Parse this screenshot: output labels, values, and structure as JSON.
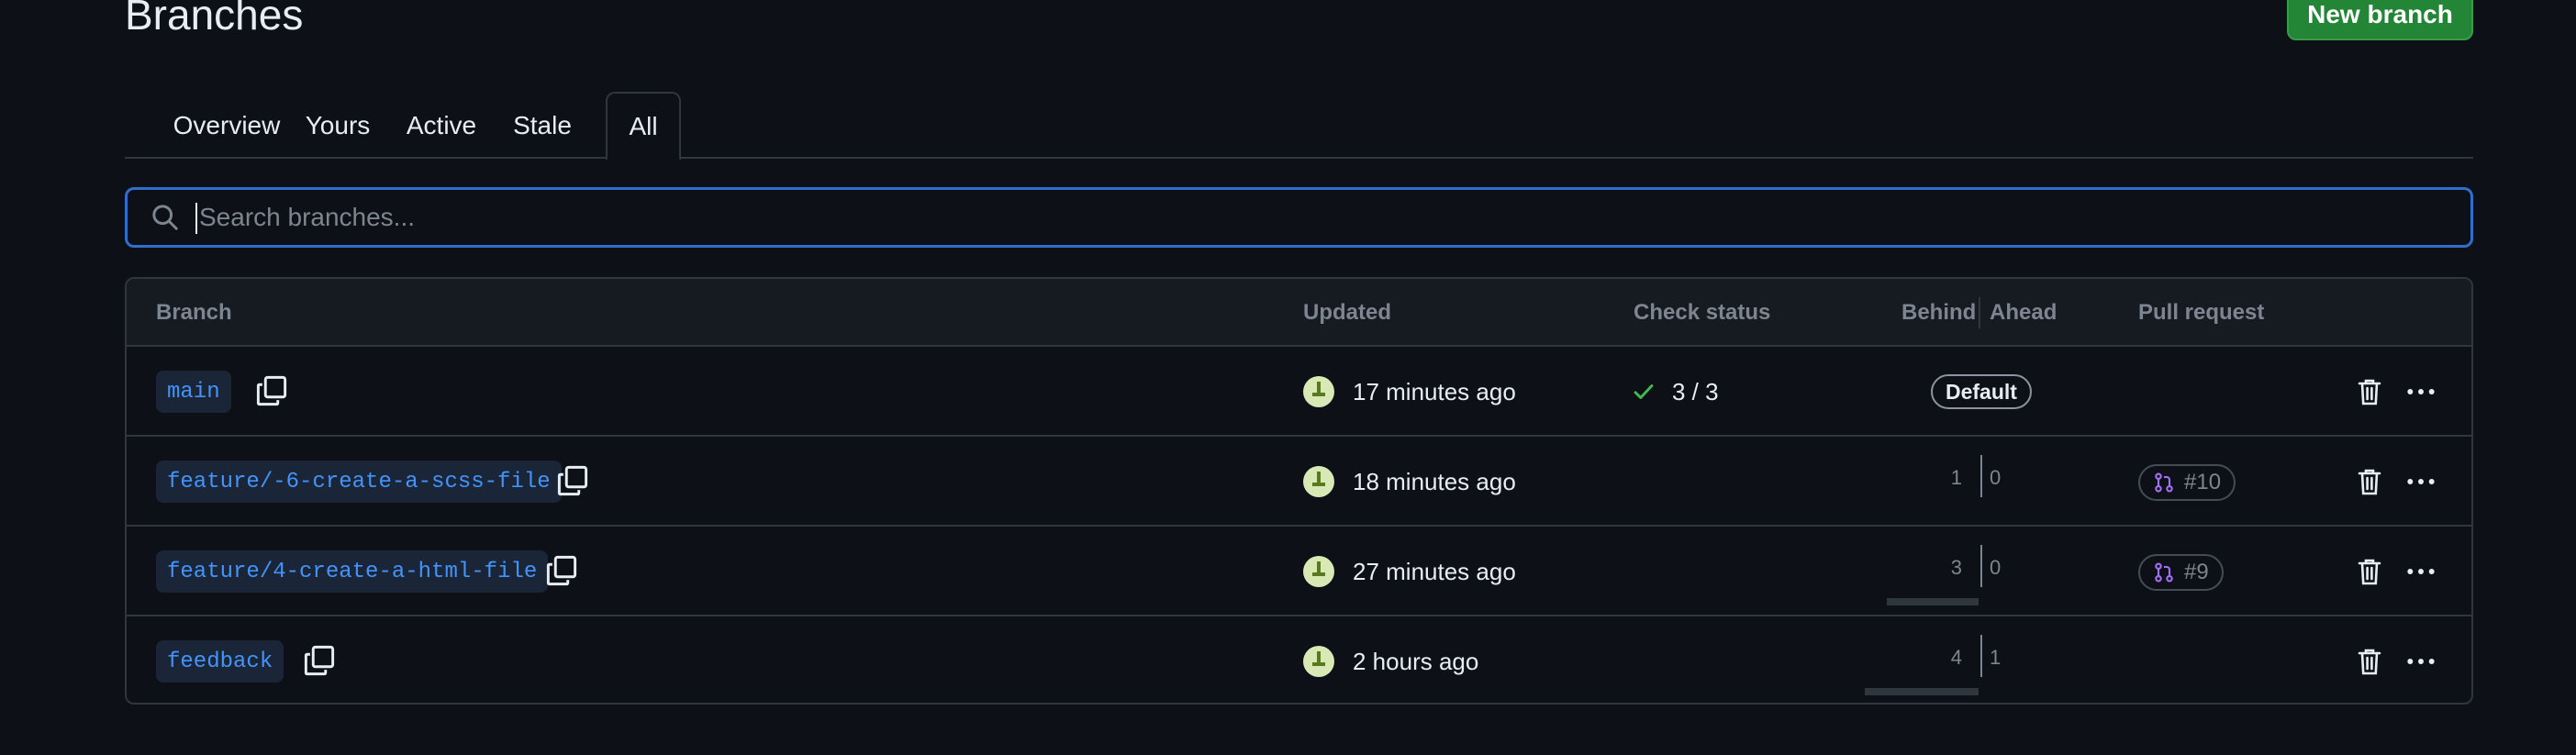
{
  "header": {
    "title": "Branches",
    "new_branch_label": "New branch"
  },
  "tabs": [
    {
      "label": "Overview",
      "active": false
    },
    {
      "label": "Yours",
      "active": false
    },
    {
      "label": "Active",
      "active": false
    },
    {
      "label": "Stale",
      "active": false
    },
    {
      "label": "All",
      "active": true
    }
  ],
  "search": {
    "placeholder": "Search branches...",
    "value": ""
  },
  "table": {
    "columns": {
      "branch": "Branch",
      "updated": "Updated",
      "check_status": "Check status",
      "behind": "Behind",
      "ahead": "Ahead",
      "pull_request": "Pull request"
    },
    "rows": [
      {
        "branch": "main",
        "updated": "17 minutes ago",
        "check": "3 / 3",
        "badge": "Default",
        "behind": "",
        "ahead": "",
        "pr": ""
      },
      {
        "branch": "feature/-6-create-a-scss-file",
        "updated": "18 minutes ago",
        "check": "",
        "badge": "",
        "behind": "1",
        "ahead": "0",
        "pr": "#10"
      },
      {
        "branch": "feature/4-create-a-html-file",
        "updated": "27 minutes ago",
        "check": "",
        "badge": "",
        "behind": "3",
        "ahead": "0",
        "pr": "#9"
      },
      {
        "branch": "feedback",
        "updated": "2 hours ago",
        "check": "",
        "badge": "",
        "behind": "4",
        "ahead": "1",
        "pr": ""
      }
    ]
  },
  "icons": {
    "search": "search-icon",
    "copy": "copy-icon",
    "check": "check-icon",
    "pull_request": "git-pull-request-icon",
    "trash": "trash-icon",
    "kebab": "kebab-horizontal-icon"
  },
  "colors": {
    "accent": "#316dca",
    "primary_button": "#238636",
    "link": "#4493f8",
    "success": "#3fb950",
    "pr_icon": "#a371f7"
  }
}
